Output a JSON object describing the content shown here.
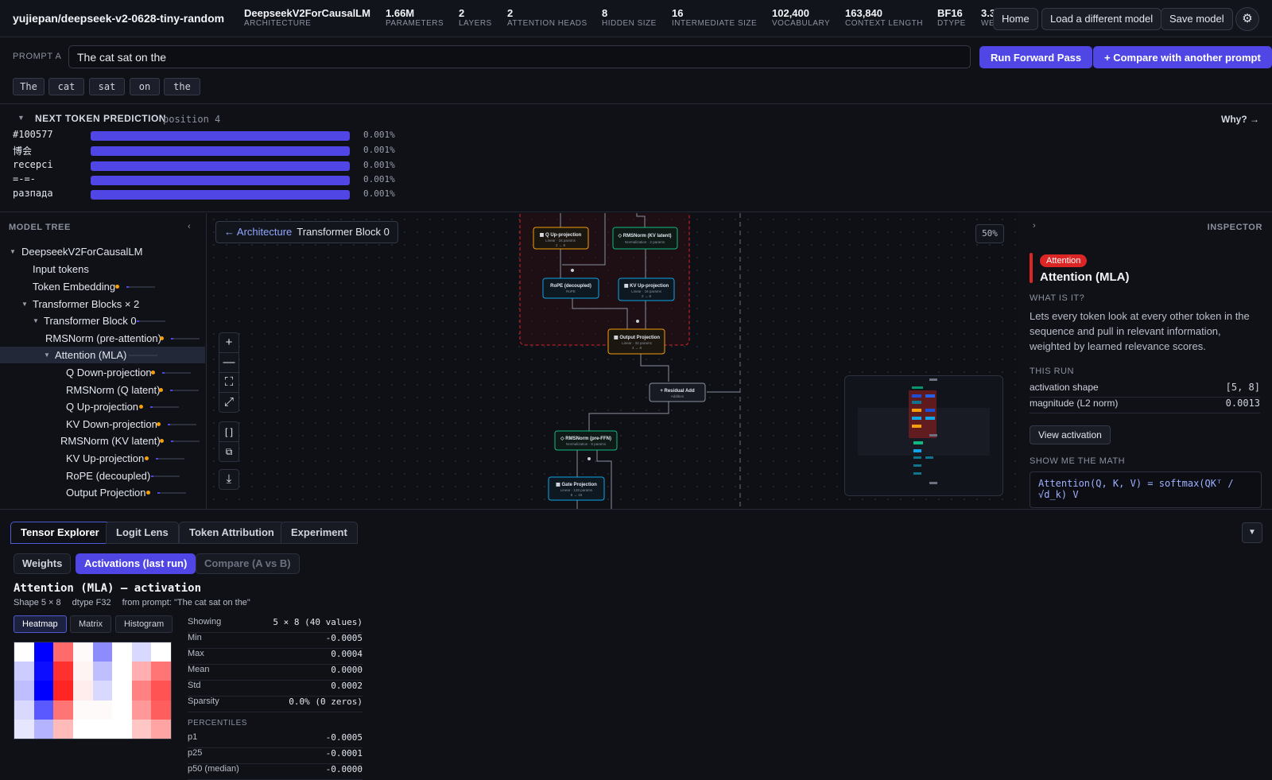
{
  "model": {
    "name": "yujiepan/deepseek-v2-0628-tiny-random",
    "stats": [
      {
        "value": "DeepseekV2ForCausalLM",
        "key": "ARCHITECTURE"
      },
      {
        "value": "1.66M",
        "key": "PARAMETERS"
      },
      {
        "value": "2",
        "key": "LAYERS"
      },
      {
        "value": "2",
        "key": "ATTENTION HEADS"
      },
      {
        "value": "8",
        "key": "HIDDEN SIZE"
      },
      {
        "value": "16",
        "key": "INTERMEDIATE SIZE"
      },
      {
        "value": "102,400",
        "key": "VOCABULARY"
      },
      {
        "value": "163,840",
        "key": "CONTEXT LENGTH"
      },
      {
        "value": "BF16",
        "key": "DTYPE"
      },
      {
        "value": "3.3",
        "key": "WE"
      }
    ]
  },
  "nav": {
    "home": "Home",
    "load": "Load a different model",
    "save": "Save model",
    "settings_icon": "gear-icon"
  },
  "prompt": {
    "label": "PROMPT A",
    "value": "The cat sat on the",
    "run": "Run Forward Pass",
    "compare": "+ Compare with another prompt",
    "tokens": [
      "The",
      "cat",
      "sat",
      "on",
      "the"
    ]
  },
  "prediction": {
    "title": "NEXT TOKEN PREDICTION",
    "position": "position 4",
    "why": "Why? →",
    "items": [
      {
        "token": "#100577",
        "pct": "0.001%"
      },
      {
        "token": "博会",
        "pct": "0.001%"
      },
      {
        "token": "recepci",
        "pct": "0.001%"
      },
      {
        "token": "=-=-",
        "pct": "0.001%"
      },
      {
        "token": "разпада",
        "pct": "0.001%"
      }
    ]
  },
  "tree": {
    "title": "MODEL TREE",
    "collapse": "‹",
    "items": [
      {
        "label": "DeepseekV2ForCausalLM",
        "caret": "▼"
      },
      {
        "label": "Input tokens"
      },
      {
        "label": "Token Embedding"
      },
      {
        "label": "Transformer Blocks × 2",
        "caret": "▼"
      },
      {
        "label": "Transformer Block 0",
        "caret": "▼"
      },
      {
        "label": "RMSNorm (pre-attention)"
      },
      {
        "label": "Attention (MLA)",
        "caret": "▼"
      },
      {
        "label": "Q Down-projection"
      },
      {
        "label": "RMSNorm (Q latent)"
      },
      {
        "label": "Q Up-projection"
      },
      {
        "label": "KV Down-projection"
      },
      {
        "label": "RMSNorm (KV latent)"
      },
      {
        "label": "KV Up-projection"
      },
      {
        "label": "RoPE (decoupled)"
      },
      {
        "label": "Output Projection"
      }
    ]
  },
  "canvas": {
    "back": "← Architecture",
    "current": "Transformer Block 0",
    "zoom": "50%",
    "nodes": {
      "q_up": {
        "title": "▦ Q Up-projection",
        "sub": "Linear · 16 params",
        "dims": "2 → 8"
      },
      "rms_kv": {
        "title": "◇ RMSNorm (KV latent)",
        "sub": "Normalization · 2 params"
      },
      "rope": {
        "title": "RoPE (decoupled)",
        "sub": "RoPE"
      },
      "kv_up": {
        "title": "▦ KV Up-projection",
        "sub": "Linear · 16 params",
        "dims": "2 → 8"
      },
      "out_proj": {
        "title": "▦ Output Projection",
        "sub": "Linear · 32 params",
        "dims": "4 → 8"
      },
      "residual": {
        "title": "+ Residual Add",
        "sub": "Addition"
      },
      "rms_ffn": {
        "title": "◇ RMSNorm (pre-FFN)",
        "sub": "Normalization · 8 params"
      },
      "gate": {
        "title": "▦ Gate Projection",
        "sub": "Linear · 128 params",
        "dims": "8 → 16"
      }
    }
  },
  "inspector": {
    "title": "INSPECTOR",
    "badge": "Attention",
    "name": "Attention (MLA)",
    "what_h": "WHAT IS IT?",
    "desc": "Lets every token look at every other token in the sequence and pull in relevant information, weighted by learned relevance scores.",
    "run_h": "THIS RUN",
    "shape_k": "activation shape",
    "shape_v": "[5, 8]",
    "mag_k": "magnitude (L2 norm)",
    "mag_v": "0.0013",
    "view": "View activation",
    "math_h": "SHOW ME THE MATH",
    "math": "Attention(Q, K, V) = softmax(QKᵀ / √d_k) V"
  },
  "bottom": {
    "tabs": [
      "Tensor Explorer",
      "Logit Lens",
      "Token Attribution",
      "Experiment"
    ],
    "sub": [
      "Weights",
      "Activations (last run)",
      "Compare (A vs B)"
    ],
    "title": "Attention (MLA) — activation",
    "shape": "Shape 5 × 8",
    "dtype": "dtype F32",
    "from": "from prompt: \"The cat sat on the\"",
    "views": [
      "Heatmap",
      "Matrix",
      "Histogram"
    ],
    "stats": [
      {
        "k": "Showing",
        "v": "5 × 8 (40 values)"
      },
      {
        "k": "Min",
        "v": "-0.0005"
      },
      {
        "k": "Max",
        "v": "0.0004"
      },
      {
        "k": "Mean",
        "v": "0.0000"
      },
      {
        "k": "Std",
        "v": "0.0002"
      },
      {
        "k": "Sparsity",
        "v": "0.0% (0 zeros)"
      }
    ],
    "pct_h": "PERCENTILES",
    "percentiles": [
      {
        "k": "p1",
        "v": "-0.0005"
      },
      {
        "k": "p25",
        "v": "-0.0001"
      },
      {
        "k": "p50 (median)",
        "v": "-0.0000"
      }
    ],
    "heatmap": [
      [
        0.0,
        -1.0,
        0.65,
        0.02,
        -0.45,
        0.0,
        -0.15,
        0.0
      ],
      [
        -0.2,
        -0.95,
        0.9,
        0.05,
        -0.25,
        0.0,
        0.35,
        0.6
      ],
      [
        -0.25,
        -1.0,
        0.95,
        0.08,
        -0.15,
        0.0,
        0.55,
        0.75
      ],
      [
        -0.15,
        -0.65,
        0.6,
        0.02,
        0.02,
        0.0,
        0.45,
        0.7
      ],
      [
        -0.1,
        -0.3,
        0.3,
        0.0,
        0.0,
        0.0,
        0.25,
        0.4
      ]
    ]
  }
}
